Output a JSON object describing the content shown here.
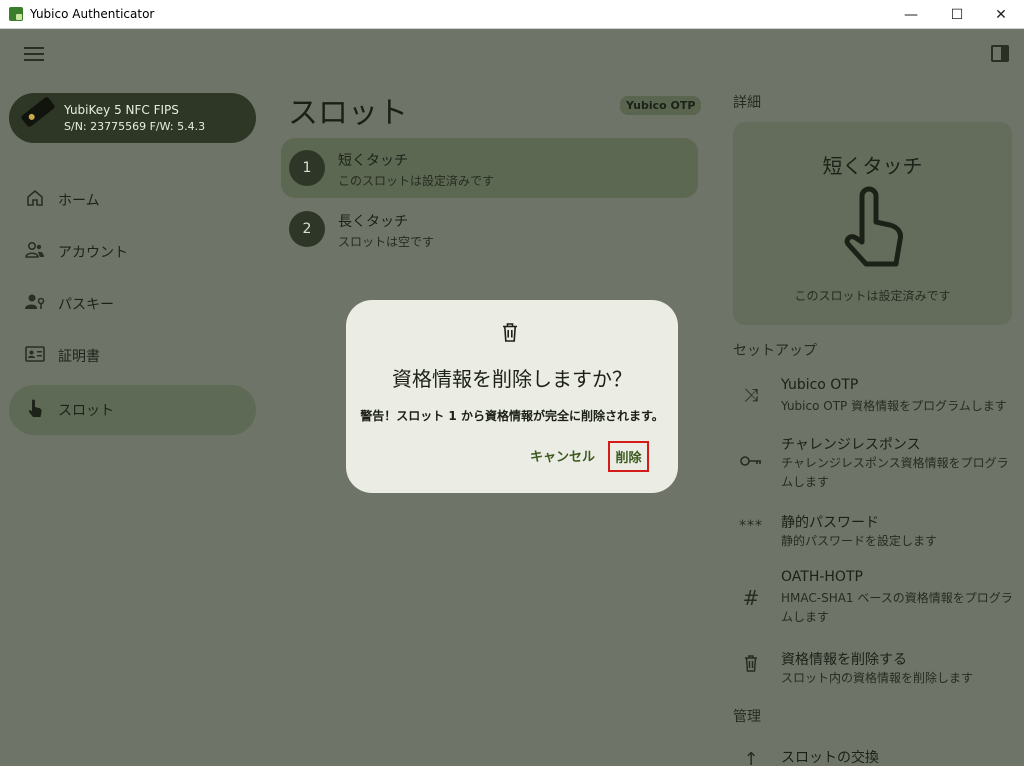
{
  "window": {
    "title": "Yubico Authenticator",
    "minimize": "—",
    "maximize": "☐",
    "close": "✕"
  },
  "device": {
    "name": "YubiKey 5 NFC FIPS",
    "info": "S/N: 23775569 F/W: 5.4.3"
  },
  "nav": {
    "items": [
      {
        "label": "ホーム",
        "icon": "home-icon"
      },
      {
        "label": "アカウント",
        "icon": "people-icon"
      },
      {
        "label": "パスキー",
        "icon": "passkey-icon"
      },
      {
        "label": "証明書",
        "icon": "certificate-icon"
      },
      {
        "label": "スロット",
        "icon": "touch-icon",
        "active": true
      }
    ]
  },
  "main": {
    "title": "スロット",
    "chip": "Yubico OTP",
    "slots": [
      {
        "number": "1",
        "name": "短くタッチ",
        "desc": "このスロットは設定済みです",
        "selected": true
      },
      {
        "number": "2",
        "name": "長くタッチ",
        "desc": "スロットは空です"
      }
    ]
  },
  "details": {
    "title": "詳細",
    "card_title": "短くタッチ",
    "card_desc": "このスロットは設定済みです"
  },
  "setup": {
    "title": "セットアップ",
    "actions": [
      {
        "title": "Yubico OTP",
        "desc": "Yubico OTP 資格情報をプログラムします",
        "icon": "shuffle-icon"
      },
      {
        "title": "チャレンジレスポンス",
        "desc": "チャレンジレスポンス資格情報をプログラムします",
        "icon": "key-icon"
      },
      {
        "title": "静的パスワード",
        "desc": "静的パスワードを設定します",
        "icon": "password-icon"
      },
      {
        "title": "OATH-HOTP",
        "desc": "HMAC-SHA1 ベースの資格情報をプログラムします",
        "icon": "hash-icon"
      },
      {
        "title": "資格情報を削除する",
        "desc": "スロット内の資格情報を削除します",
        "icon": "trash-icon"
      }
    ]
  },
  "manage": {
    "title": "管理",
    "actions": [
      {
        "title": "スロットの交換",
        "icon": "swap-icon"
      }
    ]
  },
  "dialog": {
    "title": "資格情報を削除しますか？",
    "message": "警告！スロット 1 から資格情報が完全に削除されます。",
    "cancel": "キャンセル",
    "confirm": "削除"
  },
  "colors": {
    "backdrop": "#6e7468",
    "dialog_bg": "#ebece3",
    "accent_text": "#3d5a22",
    "highlight_border": "#d51a1a"
  }
}
